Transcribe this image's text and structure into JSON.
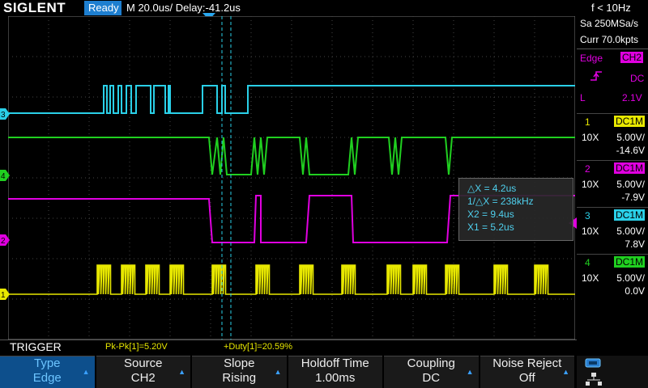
{
  "topbar": {
    "brand": "SIGLENT",
    "status": "Ready",
    "timebase": "M 20.0us/  Delay:-41.2us",
    "trigger_freq": "f < 10Hz"
  },
  "acq": {
    "sample_rate": "Sa 250MSa/s",
    "memory": "Curr 70.0kpts"
  },
  "trigger_info": {
    "type": "Edge",
    "source": "CH2",
    "coupling": "DC",
    "level_tag": "L",
    "level": "2.1V"
  },
  "channels": [
    {
      "num": "1",
      "coupling": "DC1M",
      "probe": "10X",
      "scale": "5.00V/",
      "offset": "-14.6V",
      "color": "#e8e800"
    },
    {
      "num": "2",
      "coupling": "DC1M",
      "probe": "10X",
      "scale": "5.00V/",
      "offset": "-7.9V",
      "color": "#e000e0"
    },
    {
      "num": "3",
      "coupling": "DC1M",
      "probe": "10X",
      "scale": "5.00V/",
      "offset": "7.8V",
      "color": "#2ad0e8"
    },
    {
      "num": "4",
      "coupling": "DC1M",
      "probe": "10X",
      "scale": "5.00V/",
      "offset": "0.0V",
      "color": "#20d020"
    }
  ],
  "cursor": {
    "dx": "△X = 4.2us",
    "inv_dx": "1/△X = 238kHz",
    "x2": "X2 = 9.4us",
    "x1": "X1 = 5.2us"
  },
  "measurements": {
    "pkpk": "Pk-Pk[1]=5.20V",
    "duty": "+Duty[1]=20.59%"
  },
  "menu": {
    "title": "TRIGGER",
    "keys": [
      {
        "l1": "Type",
        "l2": "Edge"
      },
      {
        "l1": "Source",
        "l2": "CH2"
      },
      {
        "l1": "Slope",
        "l2": "Rising"
      },
      {
        "l1": "Holdoff Time",
        "l2": "1.00ms"
      },
      {
        "l1": "Coupling",
        "l2": "DC"
      },
      {
        "l1": "Noise Reject",
        "l2": "Off"
      }
    ]
  },
  "marker_labels": {
    "ch1": "1",
    "ch2": "2",
    "ch3": "3",
    "ch4": "4"
  }
}
